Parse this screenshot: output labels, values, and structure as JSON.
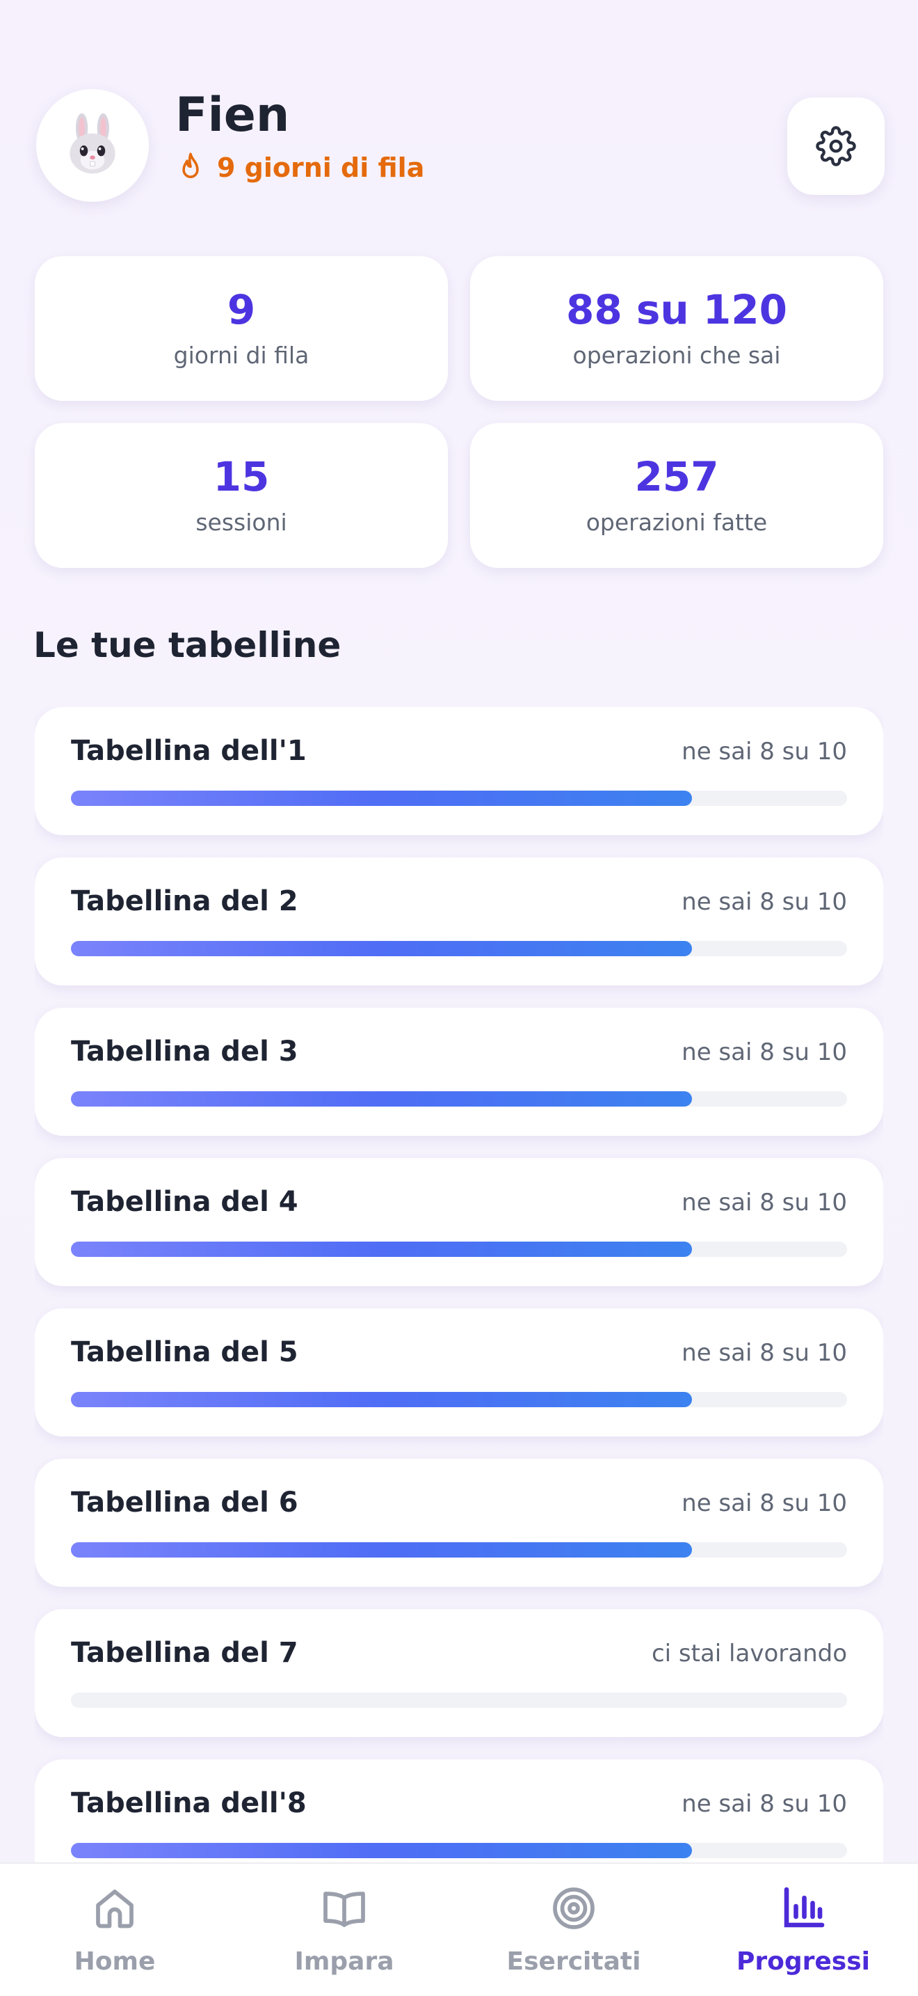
{
  "user": {
    "name": "Fien",
    "streak_label": "9 giorni di fila",
    "avatar_icon": "bunny-face-icon"
  },
  "stats": [
    {
      "value": "9",
      "label": "giorni di fila"
    },
    {
      "value": "88 su 120",
      "label": "operazioni che sai"
    },
    {
      "value": "15",
      "label": "sessioni"
    },
    {
      "value": "257",
      "label": "operazioni fatte"
    }
  ],
  "section_title": "Le tue tabelline",
  "tables": [
    {
      "name": "Tabellina dell'1",
      "status": "ne sai 8 su 10",
      "known": 8,
      "total": 10
    },
    {
      "name": "Tabellina del 2",
      "status": "ne sai 8 su 10",
      "known": 8,
      "total": 10
    },
    {
      "name": "Tabellina del 3",
      "status": "ne sai 8 su 10",
      "known": 8,
      "total": 10
    },
    {
      "name": "Tabellina del 4",
      "status": "ne sai 8 su 10",
      "known": 8,
      "total": 10
    },
    {
      "name": "Tabellina del 5",
      "status": "ne sai 8 su 10",
      "known": 8,
      "total": 10
    },
    {
      "name": "Tabellina del 6",
      "status": "ne sai 8 su 10",
      "known": 8,
      "total": 10
    },
    {
      "name": "Tabellina del 7",
      "status": "ci stai lavorando",
      "known": 0,
      "total": 10
    },
    {
      "name": "Tabellina dell'8",
      "status": "ne sai 8 su 10",
      "known": 8,
      "total": 10
    }
  ],
  "tabbar": [
    {
      "label": "Home",
      "icon": "home-icon",
      "active": false
    },
    {
      "label": "Impara",
      "icon": "book-icon",
      "active": false
    },
    {
      "label": "Esercitati",
      "icon": "target-icon",
      "active": false
    },
    {
      "label": "Progressi",
      "icon": "bar-chart-icon",
      "active": true
    }
  ],
  "colors": {
    "accent": "#4c35e0",
    "streak": "#e46a0c",
    "active_tab": "#4c2ad8",
    "inactive_tab": "#9a9fab"
  }
}
